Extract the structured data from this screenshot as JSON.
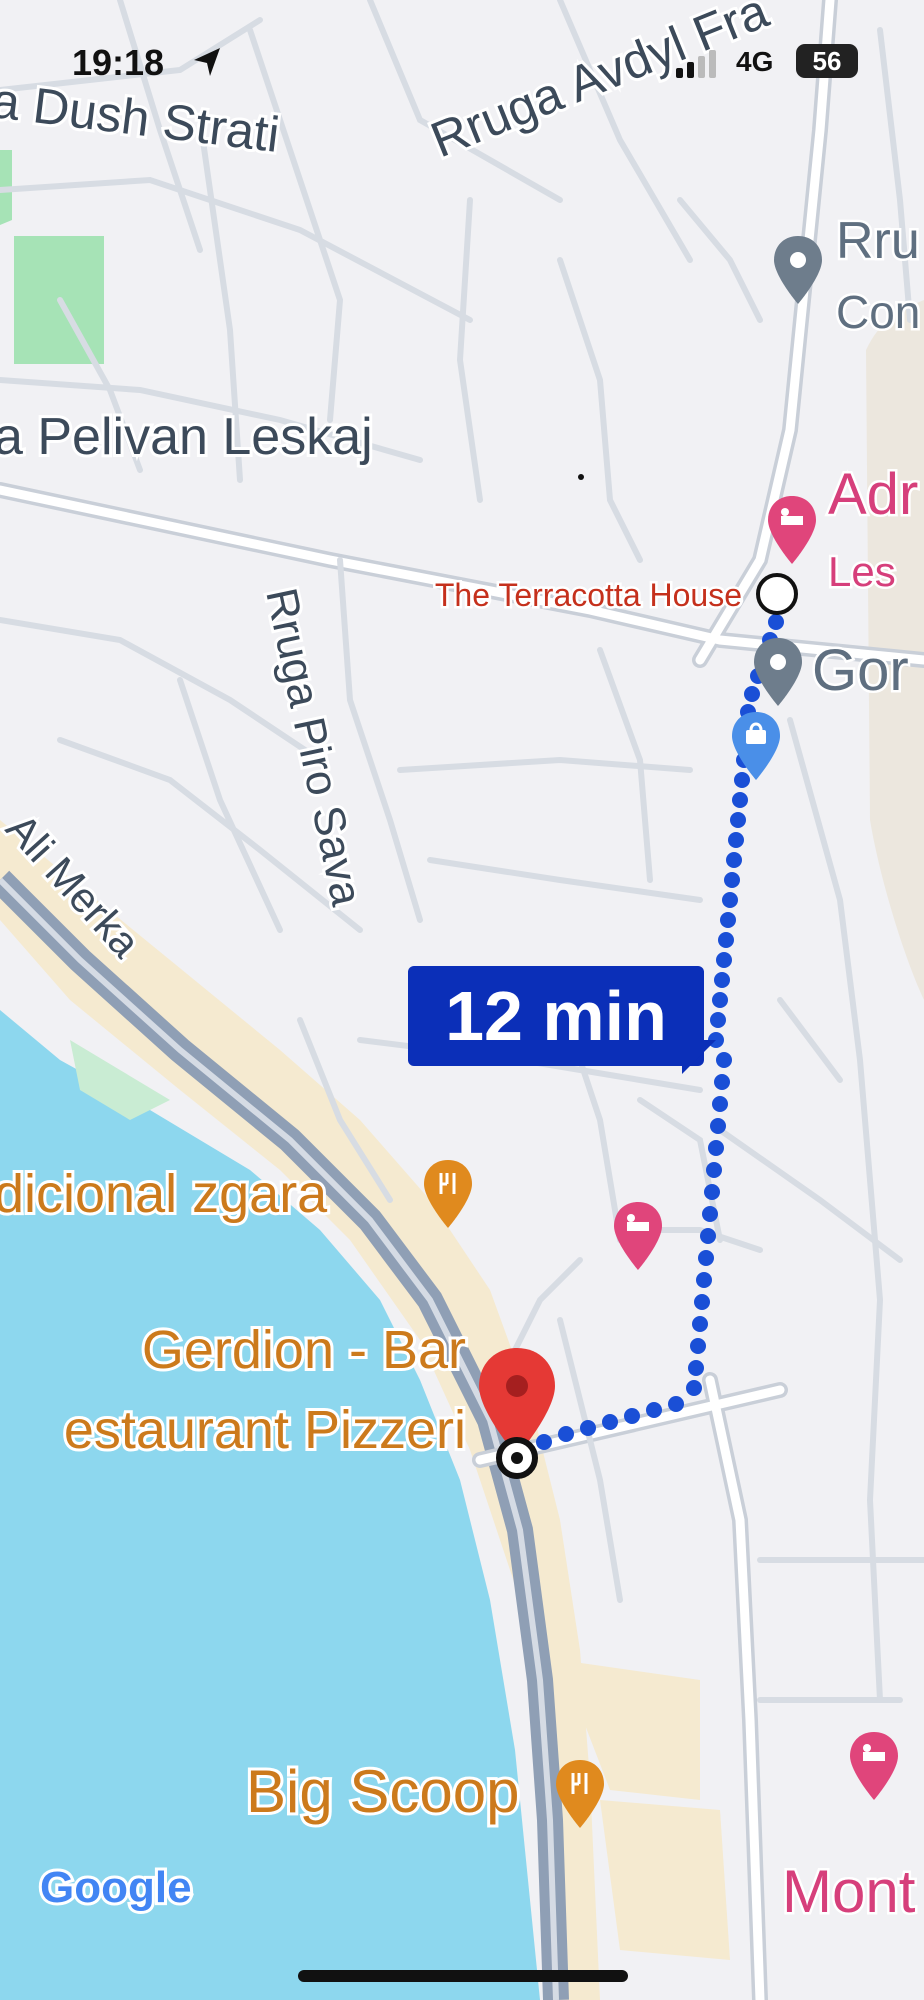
{
  "status_bar": {
    "time": "19:18",
    "network": "4G",
    "battery": "56"
  },
  "map": {
    "streets": [
      {
        "name": "a Dush Strati"
      },
      {
        "name": "Rruga Avdyl Fra"
      },
      {
        "name": "a Pelivan Leskaj"
      },
      {
        "name": "Rruga Piro Sava"
      },
      {
        "name": "Ali Merka"
      }
    ],
    "places": [
      {
        "label": "Rru\nCon",
        "icon": "location-pin-icon"
      },
      {
        "label": "Adr\nLes",
        "icon": "hotel-pin-icon"
      },
      {
        "label": "The Terracotta House",
        "icon": "route-start-icon"
      },
      {
        "label": "Gor",
        "icon": "location-pin-icon"
      },
      {
        "label": "",
        "icon": "shopping-pin-icon"
      },
      {
        "label": "dicional zgara",
        "icon": "restaurant-pin-icon"
      },
      {
        "label": "",
        "icon": "hotel-pin-icon"
      },
      {
        "label": "Gerdion - Bar\nestaurant Pizzeri",
        "icon": "destination-pin-icon"
      },
      {
        "label": "Big Scoop",
        "icon": "restaurant-pin-icon"
      },
      {
        "label": "",
        "icon": "hotel-pin-icon"
      },
      {
        "label": "Mont",
        "icon": "text-label"
      }
    ],
    "route": {
      "eta": "12 min",
      "color": "#1a4fd6"
    },
    "attribution": "Google"
  },
  "colors": {
    "land": "#f1f1f4",
    "water": "#8dd7ee",
    "beach": "#f5ead0",
    "park": "#a6e3b6",
    "coast_road": "#8f9fb5",
    "eta_bg": "#0b2fb8",
    "restaurant": "#e08a1e",
    "hotel": "#e0457b",
    "street_text": "#3c4a5a"
  }
}
